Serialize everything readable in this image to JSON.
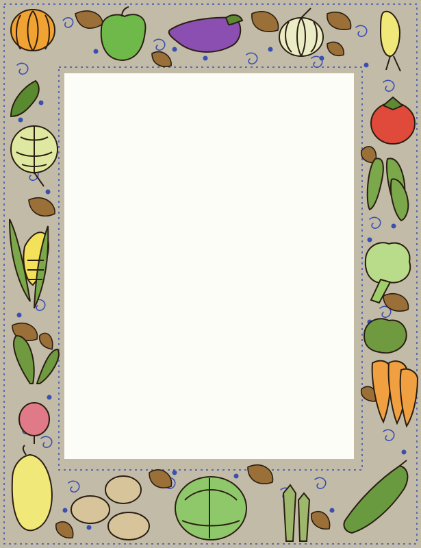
{
  "colors": {
    "border_bg": "#c2bba7",
    "panel": "#fdfdf7",
    "outline": "#2a1e12",
    "swirl": "#3a4fb0",
    "dot": "#3a4fb0"
  },
  "decorations": [
    {
      "icon": "pumpkin-icon",
      "color": "#f0a233"
    },
    {
      "icon": "bell-pepper-icon",
      "color": "#6fb84a"
    },
    {
      "icon": "eggplant-icon",
      "color": "#8a4fb0"
    },
    {
      "icon": "onion-icon",
      "color": "#e9ecc4"
    },
    {
      "icon": "leaf-icon",
      "color": "#9a6f38"
    },
    {
      "icon": "chili-pepper-icon",
      "color": "#5a8a30"
    },
    {
      "icon": "artichoke-icon",
      "color": "#dfe8a0"
    },
    {
      "icon": "corn-icon",
      "color": "#f4e15a"
    },
    {
      "icon": "beet-icon",
      "color": "#e07a88"
    },
    {
      "icon": "squash-icon",
      "color": "#f1e87a"
    },
    {
      "icon": "tomato-icon",
      "color": "#e04a3a"
    },
    {
      "icon": "pea-pod-icon",
      "color": "#7aa84a"
    },
    {
      "icon": "broccoli-icon",
      "color": "#b9dc8a"
    },
    {
      "icon": "carrot-icon",
      "color": "#f0a040"
    },
    {
      "icon": "potato-icon",
      "color": "#d8c49a"
    },
    {
      "icon": "cabbage-icon",
      "color": "#8fc86a"
    },
    {
      "icon": "asparagus-icon",
      "color": "#9db86a"
    },
    {
      "icon": "cucumber-icon",
      "color": "#6a9a40"
    }
  ]
}
